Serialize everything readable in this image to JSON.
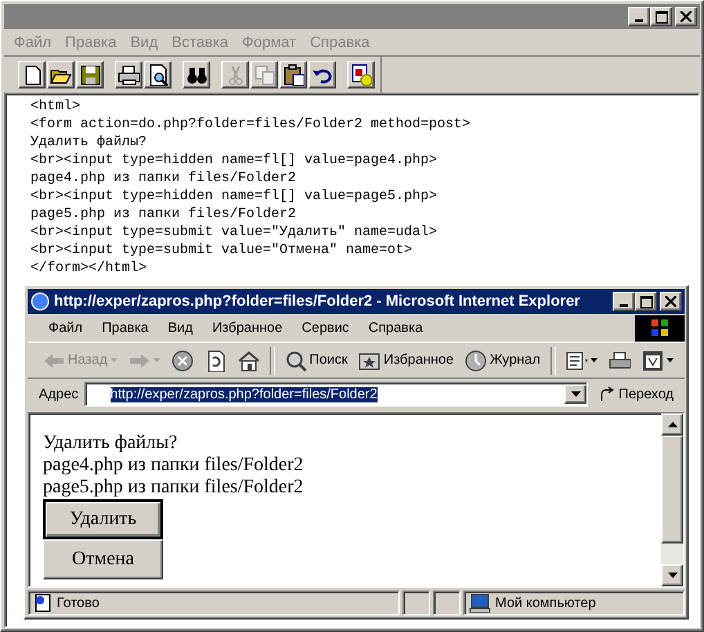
{
  "editor": {
    "menu": [
      "Файл",
      "Правка",
      "Вид",
      "Вставка",
      "Формат",
      "Справка"
    ],
    "toolbar": [
      {
        "kind": "new",
        "disabled": false
      },
      {
        "kind": "open",
        "disabled": false
      },
      {
        "kind": "save",
        "disabled": false
      },
      {
        "kind": "sep"
      },
      {
        "kind": "print",
        "disabled": false
      },
      {
        "kind": "preview",
        "disabled": false
      },
      {
        "kind": "sep"
      },
      {
        "kind": "find",
        "disabled": false
      },
      {
        "kind": "sep"
      },
      {
        "kind": "cut",
        "disabled": true
      },
      {
        "kind": "copy",
        "disabled": true
      },
      {
        "kind": "paste",
        "disabled": false
      },
      {
        "kind": "undo",
        "disabled": false
      },
      {
        "kind": "sep"
      },
      {
        "kind": "special",
        "disabled": false
      }
    ],
    "code_lines": [
      "<html>",
      "<form action=do.php?folder=files/Folder2 method=post>",
      "Удалить файлы?",
      "<br><input type=hidden name=fl[] value=page4.php>",
      "page4.php из папки files/Folder2",
      "<br><input type=hidden name=fl[] value=page5.php>",
      "page5.php из папки files/Folder2",
      "<br><input type=submit value=\"Удалить\" name=udal>",
      "<br><input type=submit value=\"Отмена\" name=ot>",
      "</form></html>"
    ]
  },
  "browser": {
    "title": "http://exper/zapros.php?folder=files/Folder2 - Microsoft Internet Explorer",
    "menu": [
      "Файл",
      "Правка",
      "Вид",
      "Избранное",
      "Сервис",
      "Справка"
    ],
    "toolbar": [
      {
        "kind": "back",
        "label": "Назад",
        "disabled": true
      },
      {
        "kind": "forward",
        "disabled": true
      },
      {
        "kind": "stop",
        "disabled": false
      },
      {
        "kind": "refresh",
        "disabled": false
      },
      {
        "kind": "home",
        "disabled": false
      },
      {
        "kind": "sep"
      },
      {
        "kind": "search",
        "label": "Поиск",
        "disabled": false
      },
      {
        "kind": "favorites",
        "label": "Избранное",
        "disabled": false
      },
      {
        "kind": "history",
        "label": "Журнал",
        "disabled": false
      },
      {
        "kind": "sep"
      },
      {
        "kind": "mail",
        "disabled": false
      },
      {
        "kind": "print",
        "disabled": false
      },
      {
        "kind": "edit",
        "disabled": false
      }
    ],
    "address": {
      "label": "Адрес",
      "value": "http://exper/zapros.php?folder=files/Folder2",
      "go": "Переход"
    },
    "page": {
      "lines": [
        "Удалить файлы?",
        "page4.php из папки files/Folder2",
        "page5.php из папки files/Folder2"
      ],
      "buttons": [
        {
          "label": "Удалить",
          "selected": true
        },
        {
          "label": "Отмена",
          "selected": false
        }
      ]
    },
    "status": {
      "text": "Готово",
      "zone": "Мой компьютер"
    }
  }
}
